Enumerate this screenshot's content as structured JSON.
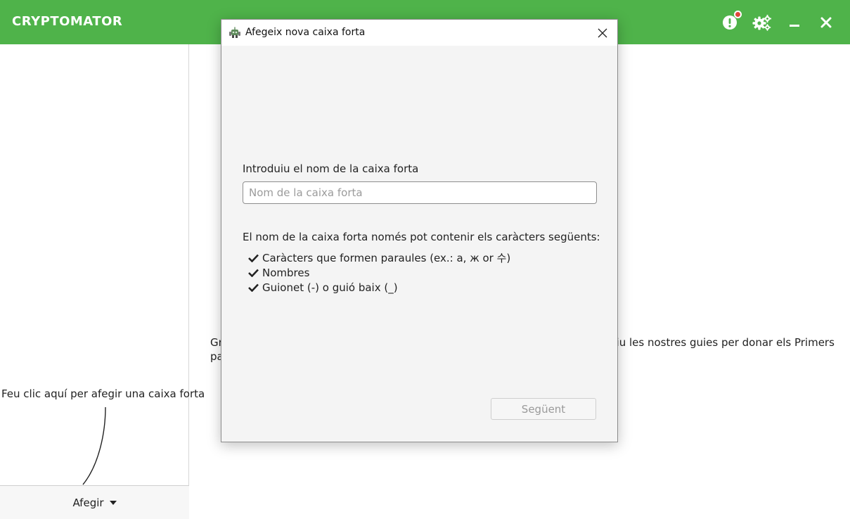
{
  "app": {
    "brand": "CRYPTOMATOR",
    "accent_color": "#4fb34a",
    "toolbar": {
      "alert_icon": "alert-circle-icon",
      "settings_icon": "gears-icon",
      "minimize_icon": "minimize-icon",
      "close_icon": "close-icon"
    }
  },
  "sidebar": {
    "hint": "Feu clic aquí per afegir una caixa forta",
    "add_button": "Afegir"
  },
  "main": {
    "text_visible_start": "Gr",
    "text_visible_end": "giu les nostres guies per donar els Primers",
    "text_line2_start": "pa"
  },
  "dialog": {
    "title": "Afegeix nova caixa forta",
    "field_label": "Introduiu el nom de la caixa forta",
    "input": {
      "placeholder": "Nom de la caixa forta",
      "value": ""
    },
    "rules_title": "El nom de la caixa forta només pot contenir els caràcters següents:",
    "rules": [
      "Caràcters que formen paraules (ex.: a, ж or 수)",
      "Nombres",
      "Guionet (-) o guió baix (_)"
    ],
    "next_button": "Següent"
  }
}
